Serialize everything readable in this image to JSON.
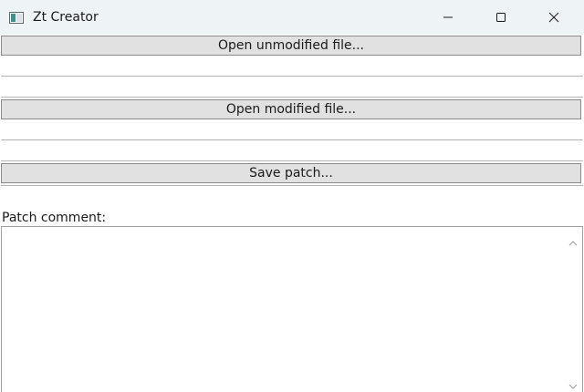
{
  "window": {
    "title": "Zt Creator",
    "app_icon": "app-window-icon",
    "controls": {
      "minimize_icon": "minimize-icon",
      "maximize_icon": "maximize-icon",
      "close_icon": "close-icon"
    }
  },
  "form": {
    "open_unmodified_label": "Open unmodified file...",
    "unmodified_path": "",
    "open_modified_label": "Open modified file...",
    "modified_path": "",
    "save_patch_label": "Save patch...",
    "comment_label": "Patch comment:",
    "comment_value": ""
  },
  "colors": {
    "titlebar_bg": "#eef3f6",
    "button_bg": "#e1e1e1",
    "button_border": "#8a8a8a",
    "text": "#1a1a1a"
  }
}
